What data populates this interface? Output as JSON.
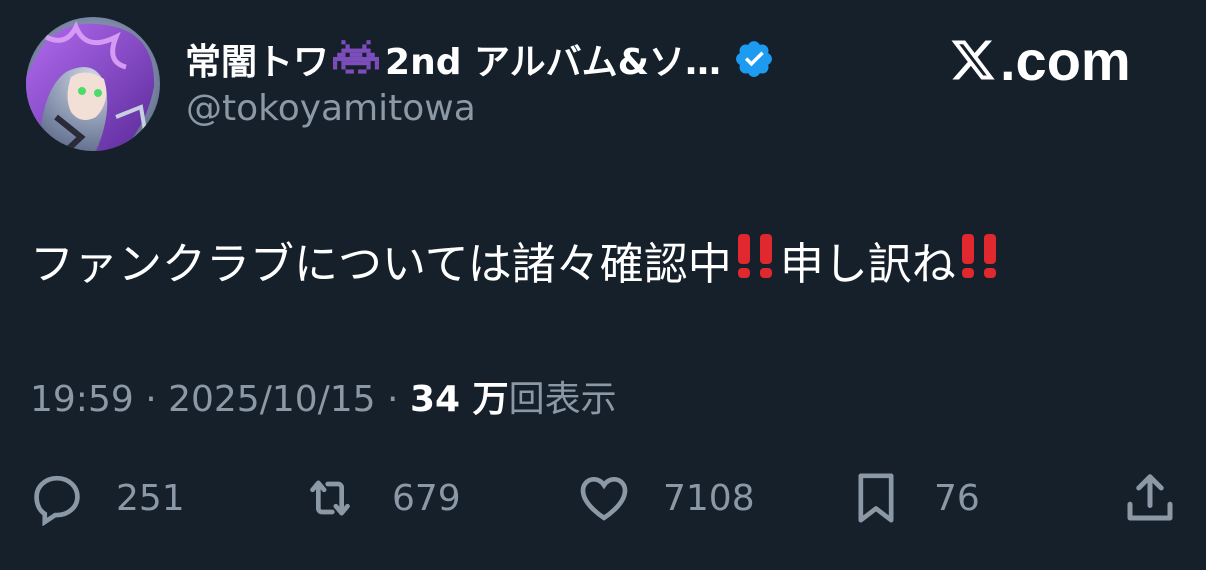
{
  "author": {
    "display_name_part1": "常闇トワ",
    "display_name_part2": "2nd アルバム&ソ…",
    "handle": "@tokoyamitowa",
    "verified": true
  },
  "site": {
    "logo_text": ".com"
  },
  "tweet": {
    "text_part1": "ファンクラブについては諸々確認中",
    "text_part2": "申し訳ね",
    "emphasis": "‼️"
  },
  "meta": {
    "time": "19:59",
    "separator": "·",
    "date": "2025/10/15",
    "views_count": "34 万",
    "views_label": "回表示"
  },
  "actions": {
    "replies": "251",
    "retweets": "679",
    "likes": "7108",
    "bookmarks": "76"
  },
  "colors": {
    "background": "#15202b",
    "secondary_text": "#8b98a5",
    "verified_blue": "#1d9bf0",
    "emphasis_red": "#e0282e",
    "alien_purple": "#7c4dbb"
  },
  "icons": {
    "avatar": "avatar-image",
    "alien": "alien-monster-icon",
    "verified": "verified-badge-icon",
    "x_logo": "x-logo-icon",
    "reply": "reply-icon",
    "retweet": "retweet-icon",
    "like": "heart-icon",
    "bookmark": "bookmark-icon",
    "share": "share-icon"
  }
}
